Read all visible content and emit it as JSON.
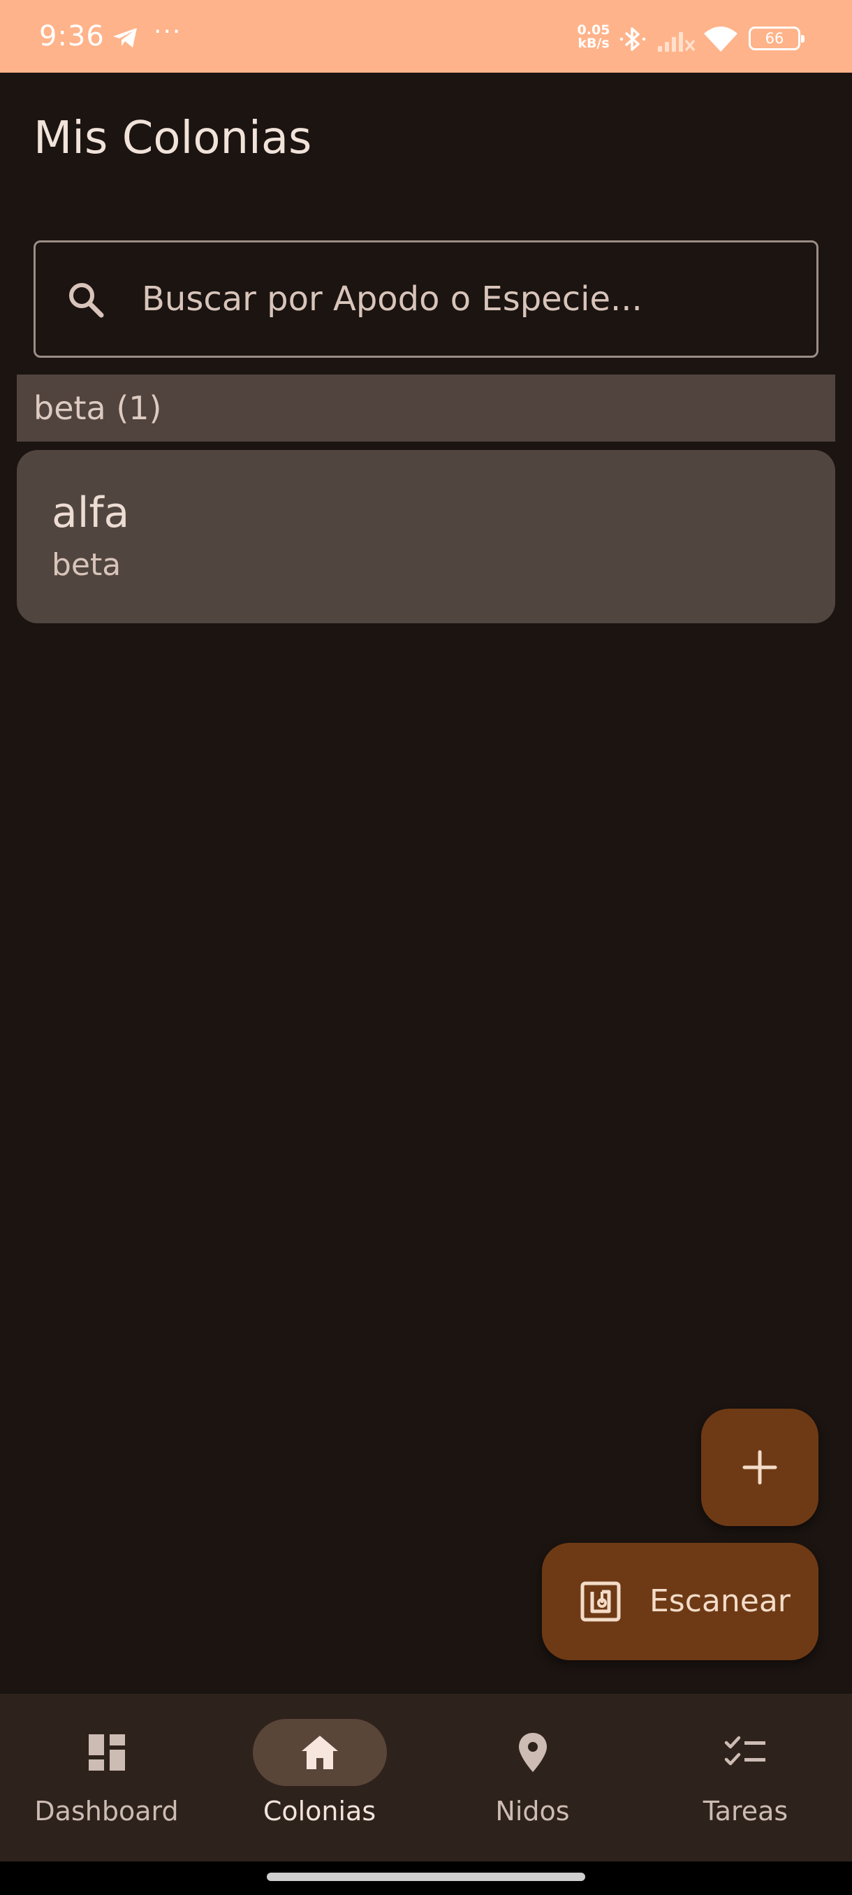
{
  "status_bar": {
    "time": "9:36",
    "notification_more": "···",
    "net_speed_value": "0.05",
    "net_speed_unit": "kB/s",
    "battery": "66",
    "icons": [
      "telegram-icon",
      "bluetooth-icon",
      "signal-icon",
      "wifi-icon",
      "battery-icon"
    ]
  },
  "header": {
    "title": "Mis Colonias"
  },
  "search": {
    "placeholder": "Buscar por Apodo o Especie...",
    "value": "",
    "icon": "search-icon"
  },
  "groups": [
    {
      "label": "beta (1)",
      "items": [
        {
          "title": "alfa",
          "subtitle": "beta"
        }
      ]
    }
  ],
  "fabs": {
    "add_icon": "plus-icon",
    "scan_label": "Escanear",
    "scan_icon": "nfc-scan-icon"
  },
  "bottom_nav": {
    "items": [
      {
        "label": "Dashboard",
        "icon": "dashboard-icon",
        "active": false
      },
      {
        "label": "Colonias",
        "icon": "home-icon",
        "active": true
      },
      {
        "label": "Nidos",
        "icon": "location-pin-icon",
        "active": false
      },
      {
        "label": "Tareas",
        "icon": "checklist-icon",
        "active": false
      }
    ]
  },
  "colors": {
    "status_bar": "#ffb38a",
    "background": "#1b1411",
    "surface_variant": "#51443e",
    "fab": "#6e3a15",
    "nav_background": "#2e221c",
    "nav_active_pill": "#5a4539"
  }
}
